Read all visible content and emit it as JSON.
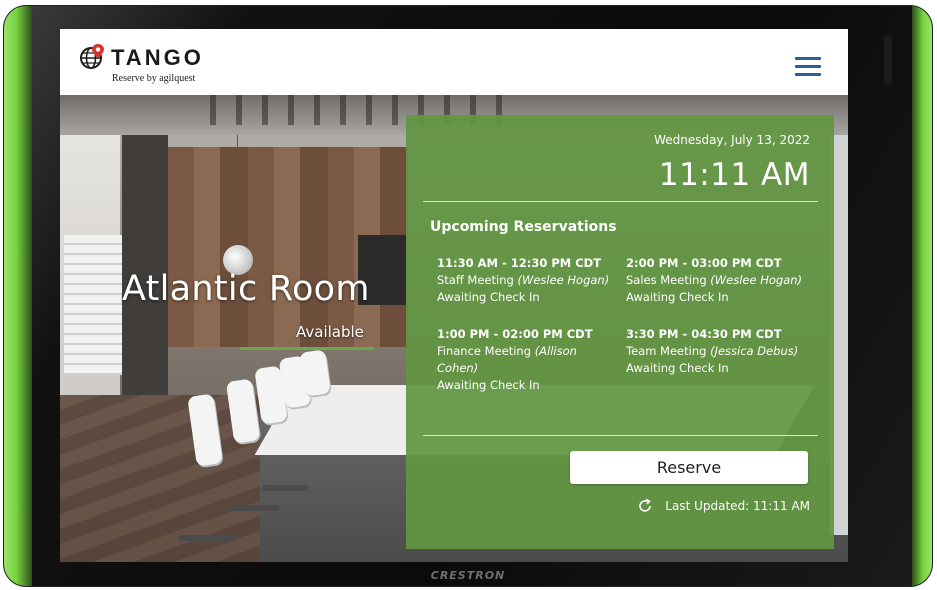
{
  "brand": {
    "name": "TANGO",
    "tagline": "Reserve by agilquest",
    "device_brand": "CRESTRON"
  },
  "header": {
    "menu_icon": "hamburger-menu-icon"
  },
  "room": {
    "name": "Atlantic Room",
    "status": "Available"
  },
  "panel": {
    "date": "Wednesday, July 13, 2022",
    "time": "11:11 AM",
    "upcoming_label": "Upcoming Reservations",
    "reservations": [
      {
        "time": "11:30 AM - 12:30 PM CDT",
        "title": "Staff Meeting",
        "organizer": "(Weslee Hogan)",
        "status": "Awaiting Check In"
      },
      {
        "time": "2:00 PM - 03:00 PM CDT",
        "title": "Sales Meeting",
        "organizer": "(Weslee Hogan)",
        "status": "Awaiting Check In"
      },
      {
        "time": "1:00 PM - 02:00 PM CDT",
        "title": "Finance Meeting",
        "organizer": "(Allison Cohen)",
        "status": "Awaiting Check In"
      },
      {
        "time": "3:30 PM - 04:30 PM CDT",
        "title": "Team Meeting",
        "organizer": "(Jessica Debus)",
        "status": "Awaiting Check In"
      }
    ],
    "reserve_label": "Reserve",
    "last_updated": "Last Updated: 11:11 AM"
  },
  "colors": {
    "panel_green": "#629642",
    "status_bar": "#6aa84f",
    "menu_blue": "#2b5f9c",
    "bezel_glow": "#74d33f"
  }
}
